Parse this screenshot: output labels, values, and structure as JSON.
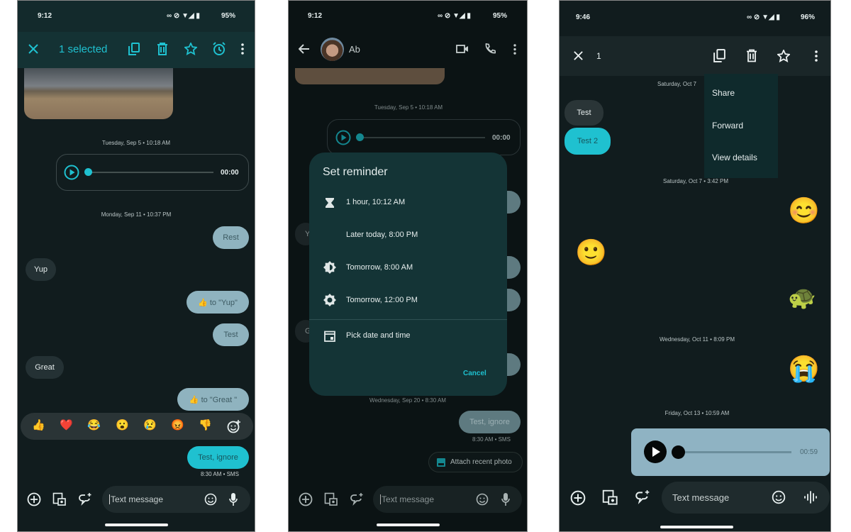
{
  "colors": {
    "accent": "#1fc1d0",
    "bg": "#111c1e",
    "outgoing": "#8fb3bf",
    "incoming": "#243134"
  },
  "panel1": {
    "status": {
      "time": "9:12",
      "battery": "95%"
    },
    "header": {
      "title": "1 selected",
      "icons": [
        "close-icon",
        "copy-icon",
        "delete-icon",
        "star-icon",
        "alarm-icon",
        "more-icon"
      ]
    },
    "dates": [
      "Tuesday, Sep 5 • 10:18 AM",
      "Monday, Sep 11 • 10:37 PM"
    ],
    "audio": {
      "duration": "00:00"
    },
    "messages": [
      {
        "dir": "out",
        "text": "Rest"
      },
      {
        "dir": "in",
        "text": "Yup"
      },
      {
        "dir": "out",
        "text": "👍 to \"Yup\""
      },
      {
        "dir": "out",
        "text": "Test"
      },
      {
        "dir": "in",
        "text": "Great"
      },
      {
        "dir": "out",
        "text": "👍 to \"Great \""
      },
      {
        "dir": "out",
        "text": "Test, ignore",
        "selected": true
      }
    ],
    "reactions": [
      "👍",
      "❤️",
      "😂",
      "😮",
      "😢",
      "😡",
      "👎"
    ],
    "meta": "8:30 AM • SMS",
    "input_placeholder": "Text message"
  },
  "panel2": {
    "status": {
      "time": "9:12",
      "battery": "95%"
    },
    "header": {
      "contact": "Ab"
    },
    "dates": [
      "Tuesday, Sep 5 • 10:18 AM",
      "Wednesday, Sep 20 • 8:30 AM"
    ],
    "audio": {
      "duration": "00:00"
    },
    "dialog": {
      "title": "Set reminder",
      "options": [
        {
          "icon": "hourglass-icon",
          "label": "1 hour, 10:12 AM"
        },
        {
          "icon": "moon-icon",
          "label": "Later today, 8:00 PM"
        },
        {
          "icon": "brightness-icon",
          "label": "Tomorrow, 8:00 AM"
        },
        {
          "icon": "sun-icon",
          "label": "Tomorrow, 12:00 PM"
        }
      ],
      "pick": "Pick date and time",
      "cancel": "Cancel"
    },
    "bg_letters": [
      "Y",
      "G"
    ],
    "last_message": "Test, ignore",
    "meta": "8:30 AM • SMS",
    "chip": "Attach recent photo",
    "input_placeholder": "Text message"
  },
  "panel3": {
    "status": {
      "time": "9:46",
      "battery": "96%"
    },
    "header": {
      "count": "1"
    },
    "menu": [
      "Share",
      "Forward",
      "View details"
    ],
    "dates": [
      "Saturday, Oct 7",
      "Saturday, Oct 7 • 3:42 PM",
      "Wednesday, Oct 11 • 8:09 PM",
      "Friday, Oct 13 • 10:59 AM"
    ],
    "messages": [
      {
        "dir": "in",
        "text": "Test"
      },
      {
        "dir": "in",
        "text": "Test 2",
        "selected": true
      }
    ],
    "emojis": [
      "😊",
      "🙂",
      "🐢",
      "😭"
    ],
    "audio": {
      "duration": "00:59"
    },
    "input_placeholder": "Text message"
  }
}
